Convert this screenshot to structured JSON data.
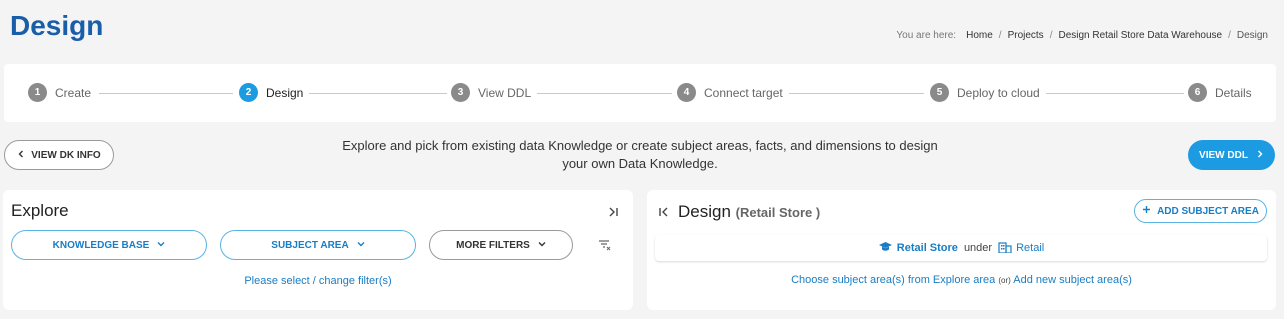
{
  "page": {
    "title": "Design"
  },
  "breadcrumb": {
    "prefix": "You are here:",
    "items": [
      "Home",
      "Projects",
      "Design Retail Store Data Warehouse",
      "Design"
    ]
  },
  "stepper": {
    "steps": [
      {
        "num": "1",
        "label": "Create"
      },
      {
        "num": "2",
        "label": "Design"
      },
      {
        "num": "3",
        "label": "View DDL"
      },
      {
        "num": "4",
        "label": "Connect target"
      },
      {
        "num": "5",
        "label": "Deploy to cloud"
      },
      {
        "num": "6",
        "label": "Details"
      }
    ],
    "active_step": 2
  },
  "toolbar": {
    "view_dk_info": "VIEW DK INFO",
    "intro_line1": "Explore and pick from existing data Knowledge or create subject areas, facts, and dimensions to design",
    "intro_line2": "your own Data Knowledge.",
    "view_ddl": "VIEW DDL"
  },
  "explore": {
    "title": "Explore",
    "filters": [
      "KNOWLEDGE BASE",
      "SUBJECT AREA",
      "MORE FILTERS"
    ],
    "hint": "Please select / change filter(s)"
  },
  "design": {
    "title": "Design",
    "subtitle": "(Retail Store )",
    "add_subject_area": "ADD SUBJECT AREA",
    "context": {
      "store": "Retail Store",
      "under": "under",
      "parent": "Retail"
    },
    "choose": {
      "part1": "Choose subject area(s) from Explore area",
      "or": "(or)",
      "part2": "Add new subject area(s)"
    }
  },
  "colors": {
    "accent": "#1d9be2",
    "title": "#1a5ea8",
    "link": "#1a7dc4"
  },
  "icons": [
    "chevron-left-icon",
    "chevron-right-icon",
    "chevron-down-icon",
    "collapse-right-icon",
    "collapse-left-icon",
    "clear-filter-icon",
    "plus-icon",
    "graduation-cap-icon",
    "building-icon"
  ]
}
